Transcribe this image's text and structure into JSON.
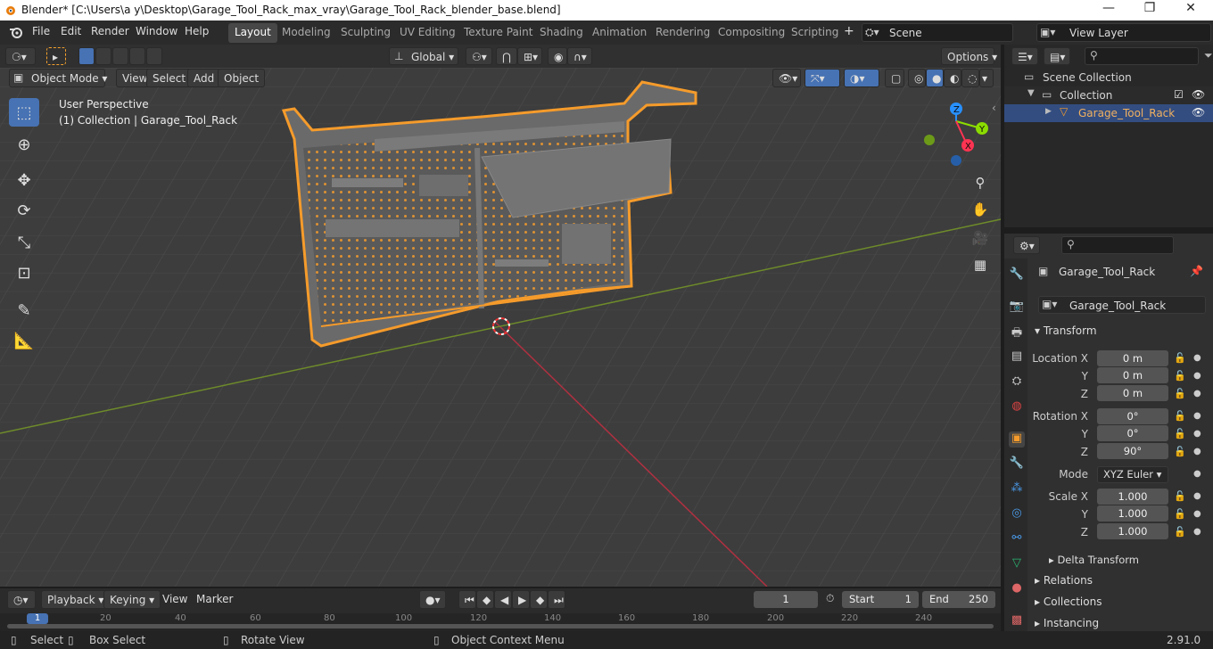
{
  "window": {
    "title": "Blender* [C:\\Users\\a y\\Desktop\\Garage_Tool_Rack_max_vray\\Garage_Tool_Rack_blender_base.blend]",
    "controls": [
      "—",
      "❐",
      "✕"
    ]
  },
  "menu": {
    "items": [
      "File",
      "Edit",
      "Render",
      "Window",
      "Help"
    ],
    "workspaces": [
      "Layout",
      "Modeling",
      "Sculpting",
      "UV Editing",
      "Texture Paint",
      "Shading",
      "Animation",
      "Rendering",
      "Compositing",
      "Scripting"
    ],
    "active_workspace": "Layout",
    "scene": "Scene",
    "view_layer": "View Layer"
  },
  "viewport_header": {
    "transform_orientation": "Global",
    "options_label": "Options",
    "mode": "Object Mode",
    "menus": [
      "View",
      "Select",
      "Add",
      "Object"
    ]
  },
  "viewport": {
    "perspective_label": "User Perspective",
    "collection_label": "(1) Collection | Garage_Tool_Rack",
    "gizmo_axes": [
      "Z",
      "Y",
      "X"
    ],
    "colors": {
      "x_axis": "#ff3352",
      "y_axis": "#8bdc00",
      "z_axis": "#2890ff",
      "selection": "#f59b2b",
      "grid_bg": "#3d3d3d"
    }
  },
  "outliner": {
    "search_placeholder": "",
    "scene_collection": "Scene Collection",
    "collection": "Collection",
    "object": "Garage_Tool_Rack"
  },
  "properties": {
    "object_name": "Garage_Tool_Rack",
    "data_name": "Garage_Tool_Rack",
    "transform_label": "Transform",
    "location_label": "Location X",
    "rotation_label": "Rotation X",
    "scale_label": "Scale X",
    "axis_y": "Y",
    "axis_z": "Z",
    "location": [
      "0 m",
      "0 m",
      "0 m"
    ],
    "rotation": [
      "0°",
      "0°",
      "90°"
    ],
    "mode_label": "Mode",
    "mode_value": "XYZ Euler",
    "scale": [
      "1.000",
      "1.000",
      "1.000"
    ],
    "delta_transform": "Delta Transform",
    "relations": "Relations",
    "collections": "Collections",
    "instancing": "Instancing"
  },
  "timeline": {
    "menus": [
      "Playback",
      "Keying",
      "View",
      "Marker"
    ],
    "current_frame": "1",
    "start_label": "Start",
    "start_value": "1",
    "end_label": "End",
    "end_value": "250",
    "ruler": [
      "1",
      "20",
      "40",
      "60",
      "80",
      "100",
      "120",
      "140",
      "160",
      "180",
      "200",
      "220",
      "240"
    ]
  },
  "statusbar": {
    "select": "Select",
    "box_select": "Box Select",
    "rotate_view": "Rotate View",
    "context_menu": "Object Context Menu",
    "version": "2.91.0"
  }
}
